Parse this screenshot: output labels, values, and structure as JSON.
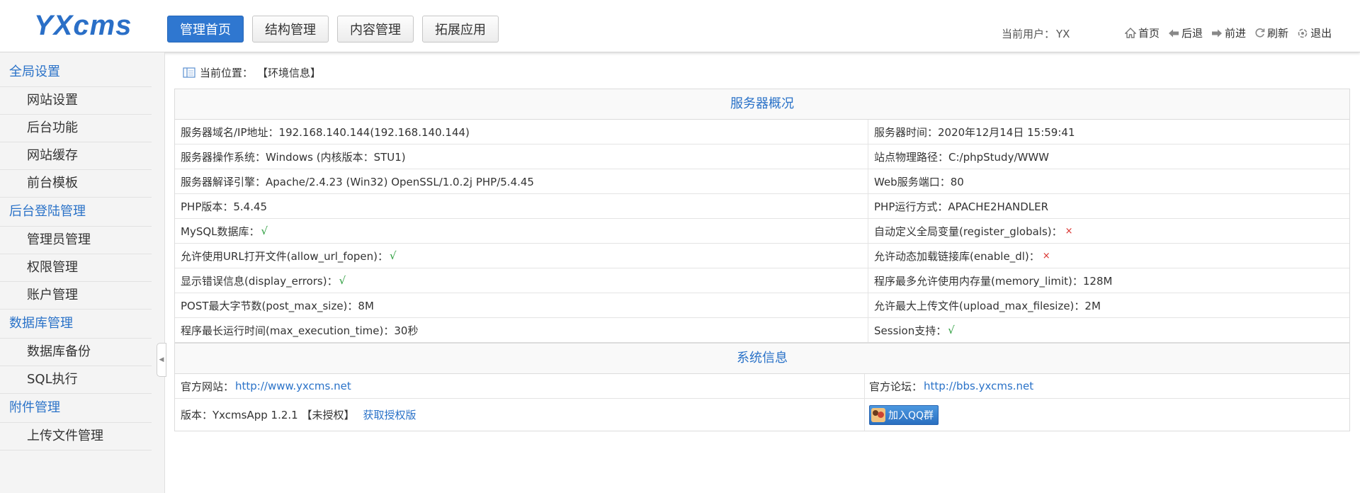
{
  "header": {
    "logo": "YXcms",
    "nav": [
      "管理首页",
      "结构管理",
      "内容管理",
      "拓展应用"
    ],
    "user_label": "当前用户：",
    "user_name": "YX",
    "tools": [
      {
        "label": "首页",
        "icon": "home-icon"
      },
      {
        "label": "后退",
        "icon": "back-arrow-icon"
      },
      {
        "label": "前进",
        "icon": "forward-arrow-icon"
      },
      {
        "label": "刷新",
        "icon": "refresh-icon"
      },
      {
        "label": "退出",
        "icon": "logout-icon"
      }
    ]
  },
  "sidebar": {
    "groups": [
      {
        "title": "全局设置",
        "items": [
          "网站设置",
          "后台功能",
          "网站缓存",
          "前台模板"
        ]
      },
      {
        "title": "后台登陆管理",
        "items": [
          "管理员管理",
          "权限管理",
          "账户管理"
        ]
      },
      {
        "title": "数据库管理",
        "items": [
          "数据库备份",
          "SQL执行"
        ]
      },
      {
        "title": "附件管理",
        "items": [
          "上传文件管理"
        ]
      }
    ]
  },
  "breadcrumb": {
    "label": "当前位置：",
    "value": "【环境信息】"
  },
  "server": {
    "title": "服务器概况",
    "rows": [
      {
        "left": "服务器域名/IP地址：192.168.140.144(192.168.140.144)",
        "right": "服务器时间：2020年12月14日 15:59:41"
      },
      {
        "left": "服务器操作系统：Windows (内核版本：STU1)",
        "right": "站点物理路径：C:/phpStudy/WWW"
      },
      {
        "left": "服务器解译引擎：Apache/2.4.23 (Win32) OpenSSL/1.0.2j PHP/5.4.45",
        "right": "Web服务端口：80"
      },
      {
        "left": "PHP版本：5.4.45",
        "right": "PHP运行方式：APACHE2HANDLER"
      },
      {
        "left": "MySQL数据库：",
        "left_mark": "√",
        "right": "自动定义全局变量(register_globals)：",
        "right_mark": "×"
      },
      {
        "left": "允许使用URL打开文件(allow_url_fopen)：",
        "left_mark": "√",
        "right": "允许动态加载链接库(enable_dl)：",
        "right_mark": "×"
      },
      {
        "left": "显示错误信息(display_errors)：",
        "left_mark": "√",
        "right": "程序最多允许使用内存量(memory_limit)：128M"
      },
      {
        "left": "POST最大字节数(post_max_size)：8M",
        "right": "允许最大上传文件(upload_max_filesize)：2M"
      },
      {
        "left": "程序最长运行时间(max_execution_time)：30秒",
        "right": "Session支持：",
        "right_mark": "√"
      }
    ]
  },
  "system": {
    "title": "系统信息",
    "official_site_label": "官方网站：",
    "official_site_url": "http://www.yxcms.net",
    "forum_label": "官方论坛：",
    "forum_url": "http://bbs.yxcms.net",
    "version_text": "版本：YxcmsApp 1.2.1 【未授权】",
    "license_link": "获取授权版",
    "qq_button": "加入QQ群"
  },
  "colors": {
    "accent": "#2f77d0",
    "link": "#2a72c8",
    "ok": "#2a9d3c",
    "no": "#d9302c"
  }
}
